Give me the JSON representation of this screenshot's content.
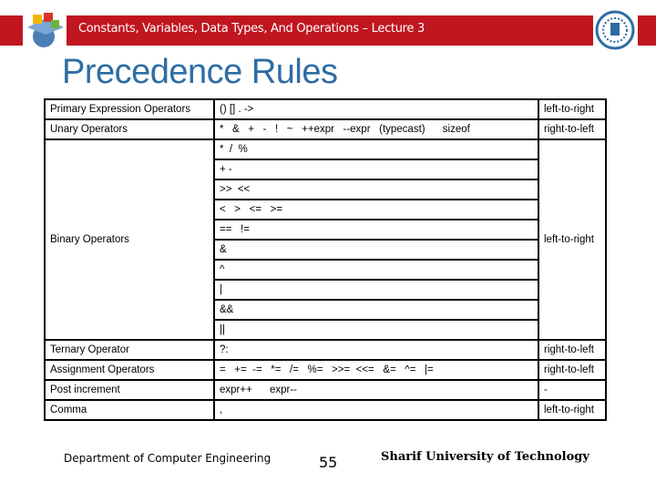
{
  "header": {
    "title": "Constants, Variables, Data Types, And Operations – Lecture 3",
    "color": "#c0161f"
  },
  "slide_title": "Precedence Rules",
  "rows": [
    {
      "category": "Primary Expression Operators",
      "ops": [
        "() [] . ->"
      ],
      "assoc": "left-to-right"
    },
    {
      "category": "Unary Operators",
      "ops": [
        "*   &   +   -   !   ~   ++expr   --expr   (typecast)      sizeof"
      ],
      "assoc": "right-to-left"
    },
    {
      "category": "Binary Operators",
      "ops": [
        "*  /  %",
        "+ -",
        ">>  <<",
        "<   >   <=   >=",
        "==   !=",
        "&",
        "^",
        "|",
        "&&",
        "||"
      ],
      "assoc": "left-to-right"
    },
    {
      "category": "Ternary Operator",
      "ops": [
        "?:"
      ],
      "assoc": "right-to-left"
    },
    {
      "category": "Assignment Operators",
      "ops": [
        "=   +=  -=   *=   /=   %=   >>=  <<=   &=   ^=   |="
      ],
      "assoc": "right-to-left"
    },
    {
      "category": "Post increment",
      "ops": [
        "expr++      expr--"
      ],
      "assoc": "-"
    },
    {
      "category": "Comma",
      "ops": [
        ","
      ],
      "assoc": "left-to-right"
    }
  ],
  "footer": {
    "department": "Department of Computer Engineering",
    "page": "55",
    "university": "Sharif University of Technology"
  }
}
